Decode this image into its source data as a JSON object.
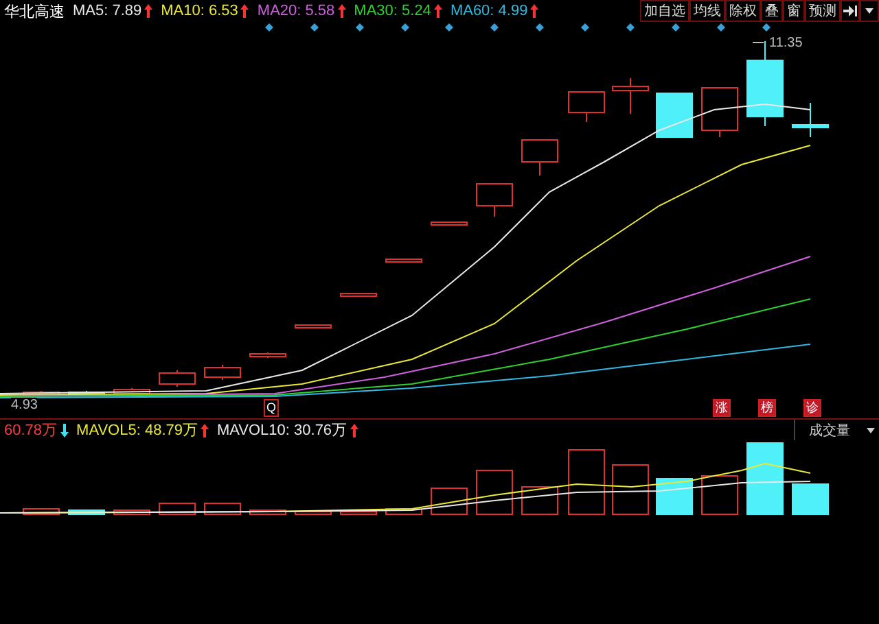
{
  "stock": {
    "name": "华北高速"
  },
  "ma": [
    {
      "label": "MA5: 7.89",
      "color": "#e8e8e8",
      "rising": true
    },
    {
      "label": "MA10: 6.53",
      "color": "#e8e83a",
      "rising": true
    },
    {
      "label": "MA20: 5.58",
      "color": "#d060e0",
      "rising": true
    },
    {
      "label": "MA30: 5.24",
      "color": "#30d030",
      "rising": true
    },
    {
      "label": "MA60: 4.99",
      "color": "#30b8e0",
      "rising": true
    }
  ],
  "toolbar": [
    {
      "label": "加自选"
    },
    {
      "label": "均线"
    },
    {
      "label": "除权"
    },
    {
      "label": "叠"
    },
    {
      "label": "窗"
    },
    {
      "label": "预测"
    }
  ],
  "price_labels": {
    "high": "11.35",
    "low": "4.93"
  },
  "badges": [
    "Q",
    "涨",
    "榜",
    "诊"
  ],
  "volume": {
    "indicators": [
      {
        "label": "60.78万",
        "color": "#ff3a3a",
        "rising": false
      },
      {
        "label": "MAVOL5: 48.79万",
        "color": "#e8e83a",
        "rising": true
      },
      {
        "label": "MAVOL10: 30.76万",
        "color": "#e8e8e8",
        "rising": true
      }
    ],
    "selector": "成交量"
  }
}
